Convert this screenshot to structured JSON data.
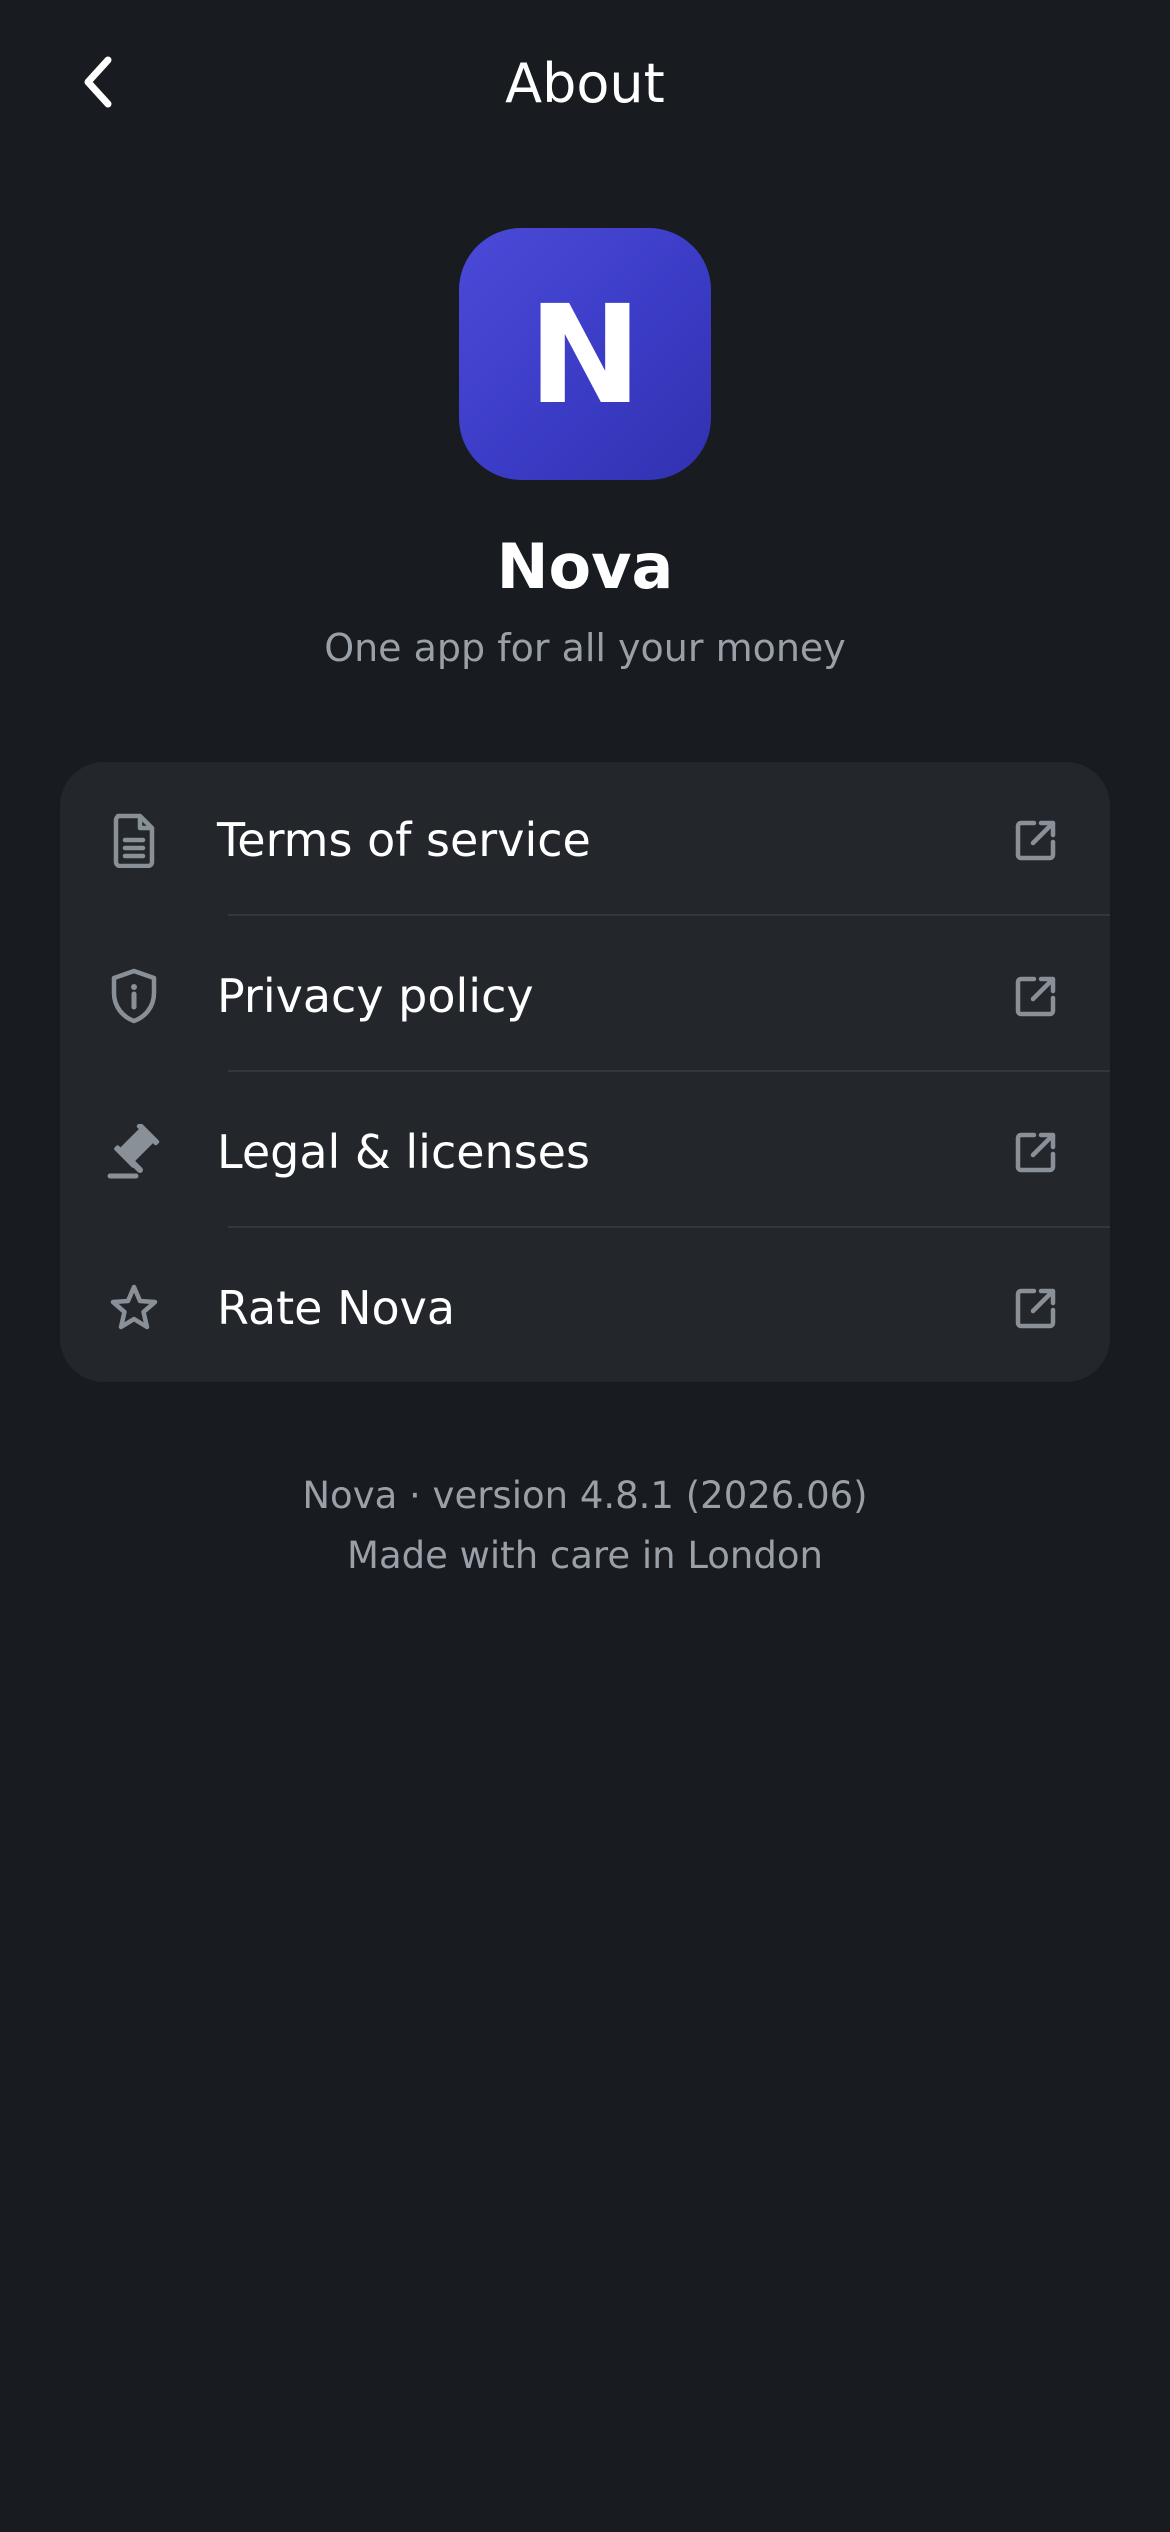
{
  "header": {
    "title": "About",
    "back_icon": "chevron-left-icon"
  },
  "app": {
    "icon_letter": "N",
    "name": "Nova",
    "tagline": "One app for all your money",
    "brand_color": "#3b3cc6"
  },
  "links": [
    {
      "label": "Terms of service",
      "icon": "document-icon",
      "trailing_icon": "external-link-icon"
    },
    {
      "label": "Privacy policy",
      "icon": "shield-info-icon",
      "trailing_icon": "external-link-icon"
    },
    {
      "label": "Legal & licenses",
      "icon": "gavel-icon",
      "trailing_icon": "external-link-icon"
    },
    {
      "label": "Rate Nova",
      "icon": "star-icon",
      "trailing_icon": "external-link-icon"
    }
  ],
  "footer": {
    "version_line": "Nova · version 4.8.1 (2026.06)",
    "made_line": "Made with care in London"
  },
  "colors": {
    "background": "#181b1f",
    "card": "#23272b",
    "muted_text": "#9aa0a8",
    "icon": "#8a9098"
  }
}
